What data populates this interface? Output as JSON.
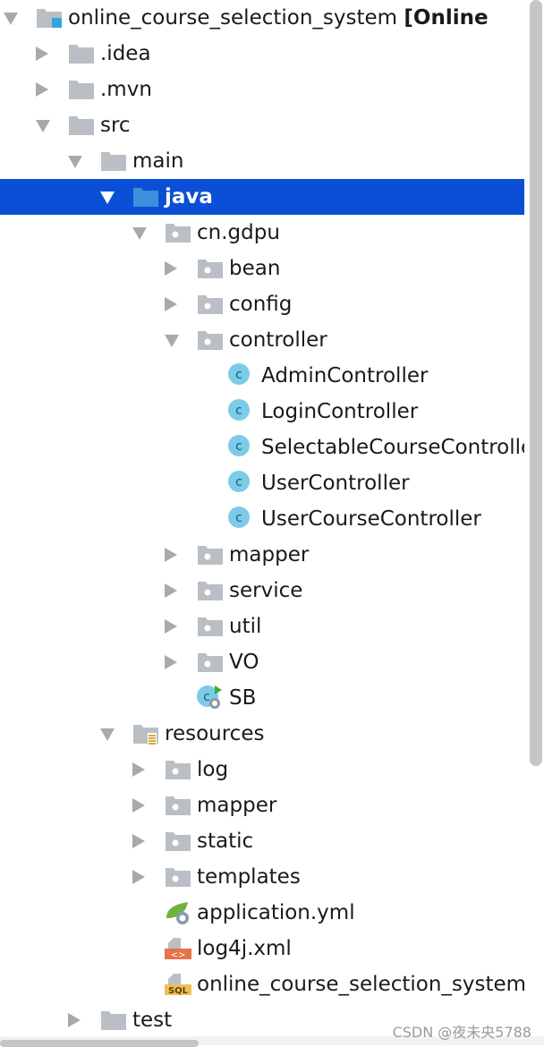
{
  "project_root": {
    "name": "online_course_selection_system",
    "module": "[Online"
  },
  "rows": [
    {
      "level": 0,
      "arrow": "expanded",
      "icon": "module-folder-icon",
      "label": "online_course_selection_system ",
      "suffix": "[Online"
    },
    {
      "level": 1,
      "arrow": "collapsed",
      "icon": "folder-icon",
      "label": ".idea"
    },
    {
      "level": 1,
      "arrow": "collapsed",
      "icon": "folder-icon",
      "label": ".mvn"
    },
    {
      "level": 1,
      "arrow": "expanded",
      "icon": "folder-icon",
      "label": "src"
    },
    {
      "level": 2,
      "arrow": "expanded",
      "icon": "folder-icon",
      "label": "main"
    },
    {
      "level": 3,
      "arrow": "expanded",
      "icon": "source-folder-icon",
      "label": "java",
      "selected": true
    },
    {
      "level": 4,
      "arrow": "expanded",
      "icon": "package-icon",
      "label": "cn.gdpu"
    },
    {
      "level": 5,
      "arrow": "collapsed",
      "icon": "package-icon",
      "label": "bean"
    },
    {
      "level": 5,
      "arrow": "collapsed",
      "icon": "package-icon",
      "label": "config"
    },
    {
      "level": 5,
      "arrow": "expanded",
      "icon": "package-icon",
      "label": "controller"
    },
    {
      "level": 6,
      "arrow": "none",
      "icon": "class-icon",
      "label": "AdminController"
    },
    {
      "level": 6,
      "arrow": "none",
      "icon": "class-icon",
      "label": "LoginController"
    },
    {
      "level": 6,
      "arrow": "none",
      "icon": "class-icon",
      "label": "SelectableCourseController"
    },
    {
      "level": 6,
      "arrow": "none",
      "icon": "class-icon",
      "label": "UserController"
    },
    {
      "level": 6,
      "arrow": "none",
      "icon": "class-icon",
      "label": "UserCourseController"
    },
    {
      "level": 5,
      "arrow": "collapsed",
      "icon": "package-icon",
      "label": "mapper"
    },
    {
      "level": 5,
      "arrow": "collapsed",
      "icon": "package-icon",
      "label": "service"
    },
    {
      "level": 5,
      "arrow": "collapsed",
      "icon": "package-icon",
      "label": "util"
    },
    {
      "level": 5,
      "arrow": "collapsed",
      "icon": "package-icon",
      "label": "VO"
    },
    {
      "level": 5,
      "arrow": "none",
      "icon": "spring-boot-class-icon",
      "label": "SB"
    },
    {
      "level": 3,
      "arrow": "expanded",
      "icon": "resources-folder-icon",
      "label": "resources"
    },
    {
      "level": 4,
      "arrow": "collapsed",
      "icon": "package-icon",
      "label": "log"
    },
    {
      "level": 4,
      "arrow": "collapsed",
      "icon": "package-icon",
      "label": "mapper"
    },
    {
      "level": 4,
      "arrow": "collapsed",
      "icon": "package-icon",
      "label": "static"
    },
    {
      "level": 4,
      "arrow": "collapsed",
      "icon": "package-icon",
      "label": "templates"
    },
    {
      "level": 4,
      "arrow": "none",
      "icon": "spring-yml-icon",
      "label": "application.yml"
    },
    {
      "level": 4,
      "arrow": "none",
      "icon": "xml-file-icon",
      "label": "log4j.xml"
    },
    {
      "level": 4,
      "arrow": "none",
      "icon": "sql-file-icon",
      "label": "online_course_selection_system.sql"
    },
    {
      "level": 2,
      "arrow": "collapsed",
      "icon": "folder-icon",
      "label": "test"
    }
  ],
  "watermark": "CSDN @夜未央5788",
  "colors": {
    "selection": "#0b4fd6",
    "folder": "#b9bfc4",
    "class": "#6ec6e6",
    "source_folder": "#3d8fdc"
  }
}
